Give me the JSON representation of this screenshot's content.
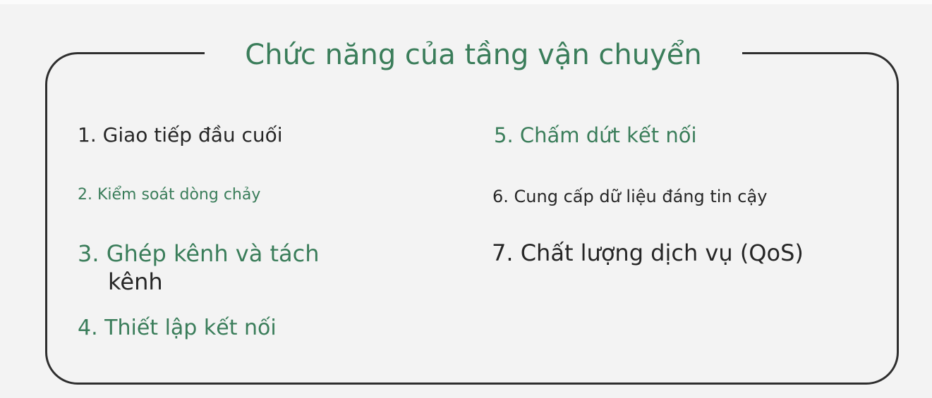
{
  "title": "Chức năng của tầng vận chuyển",
  "colors": {
    "accent_green": "#3a7d5a",
    "text_dark": "#262626",
    "frame_border": "#2e2e2e",
    "background": "#f3f3f3"
  },
  "items": [
    {
      "text": "1. Giao tiếp đầu cuối",
      "color": "dark"
    },
    {
      "text": "2. Kiểm soát dòng chảy",
      "color": "green"
    },
    {
      "text": "3. Ghép kênh và tách",
      "text_cont": "kênh",
      "color": "green"
    },
    {
      "text": "4. Thiết lập kết nối",
      "color": "green"
    },
    {
      "text": "5. Chấm dứt kết nối",
      "color": "green"
    },
    {
      "text": "6. Cung cấp dữ liệu đáng tin cậy",
      "color": "dark"
    },
    {
      "text": "7. Chất lượng dịch vụ (QoS)",
      "color": "dark"
    }
  ]
}
